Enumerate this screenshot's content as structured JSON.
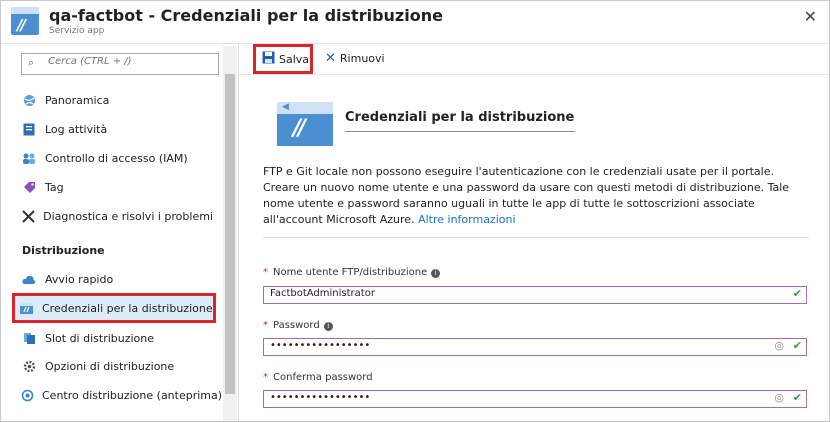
{
  "window": {
    "title": "qa-factbot - Credenziali per la distribuzione",
    "subtitle": "Servizio app",
    "close_icon": "close-icon"
  },
  "sidebar": {
    "search_placeholder": "Cerca (CTRL + /)",
    "collapse_glyph": "«",
    "items_top": [
      {
        "label": "Panoramica",
        "icon": "globe-icon"
      },
      {
        "label": "Log attività",
        "icon": "log-icon"
      },
      {
        "label": "Controllo di accesso (IAM)",
        "icon": "people-icon"
      },
      {
        "label": "Tag",
        "icon": "tag-icon"
      },
      {
        "label": "Diagnostica e risolvi i problemi",
        "icon": "tools-icon"
      }
    ],
    "section_title": "Distribuzione",
    "items_deploy": [
      {
        "label": "Avvio rapido",
        "icon": "cloud-icon"
      },
      {
        "label": "Credenziali per la distribuzione",
        "icon": "credentials-icon",
        "selected": true
      },
      {
        "label": "Slot di distribuzione",
        "icon": "slots-icon"
      },
      {
        "label": "Opzioni di distribuzione",
        "icon": "gear-icon"
      },
      {
        "label": "Centro distribuzione (anteprima)",
        "icon": "deploy-center-icon"
      }
    ]
  },
  "toolbar": {
    "save_label": "Salva",
    "remove_label": "Rimuovi"
  },
  "main": {
    "heading": "Credenziali per la distribuzione",
    "description": "FTP e Git locale non possono eseguire l'autenticazione con le credenziali usate per il portale. Creare un nuovo nome utente e una password da usare con questi metodi di distribuzione. Tale nome utente e password saranno uguali in tutte le app di tutte le sottoscrizioni associate all'account Microsoft Azure.",
    "more_link": "Altre informazioni",
    "fields": {
      "username_label": "Nome utente FTP/distribuzione",
      "username_value": "FactbotAdministrator",
      "password_label": "Password",
      "password_value": "•••••••••••••••••",
      "confirm_label": "Conferma password",
      "confirm_value": "•••••••••••••••••"
    }
  },
  "colors": {
    "accent": "#4b8fd0",
    "highlight_border": "#d9232d",
    "field_border": "#a06bb5",
    "valid": "#3a9c3a",
    "link": "#1a6fc4"
  }
}
